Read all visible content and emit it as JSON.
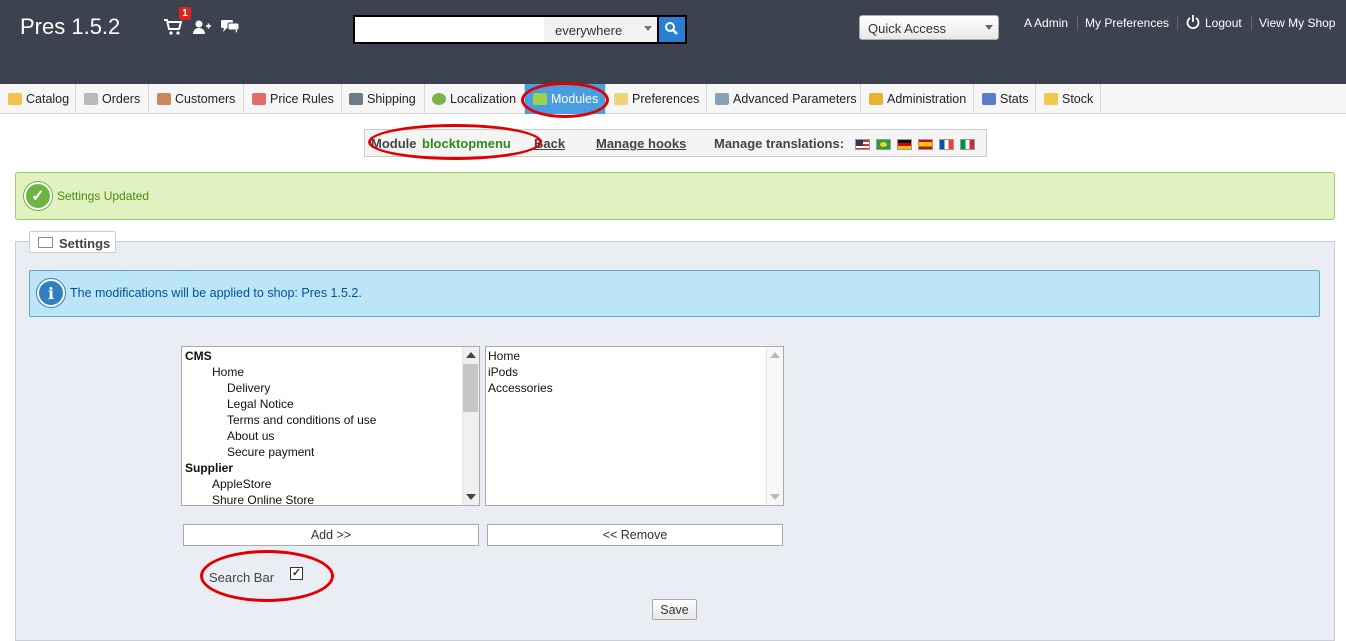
{
  "header": {
    "shop_title": "Pres 1.5.2",
    "orders_badge": "1",
    "search": {
      "value": "",
      "scope": "everywhere"
    },
    "quick_access": "Quick Access",
    "links": {
      "admin": "A Admin",
      "preferences": "My Preferences",
      "logout": "Logout",
      "view_shop": "View My Shop"
    }
  },
  "tabs": [
    {
      "label": "Catalog",
      "icon": "folder-icon"
    },
    {
      "label": "Orders",
      "icon": "cart-icon"
    },
    {
      "label": "Customers",
      "icon": "customer-icon"
    },
    {
      "label": "Price Rules",
      "icon": "price-tag-icon"
    },
    {
      "label": "Shipping",
      "icon": "truck-icon"
    },
    {
      "label": "Localization",
      "icon": "globe-icon"
    },
    {
      "label": "Modules",
      "icon": "puzzle-icon",
      "active": true
    },
    {
      "label": "Preferences",
      "icon": "preferences-icon"
    },
    {
      "label": "Advanced Parameters",
      "icon": "wrench-icon"
    },
    {
      "label": "Administration",
      "icon": "key-icon"
    },
    {
      "label": "Stats",
      "icon": "bar-chart-icon"
    },
    {
      "label": "Stock",
      "icon": "box-icon"
    }
  ],
  "module_bar": {
    "module_prefix": "Module",
    "module_name": "blocktopmenu",
    "back": "Back",
    "manage_hooks": "Manage hooks",
    "manage_translations": "Manage translations:",
    "flags": [
      "en",
      "br",
      "de",
      "es",
      "fr",
      "it"
    ]
  },
  "success_message": "Settings Updated",
  "settings": {
    "legend": "Settings",
    "info": "The modifications will be applied to shop: Pres 1.5.2.",
    "available_items": [
      {
        "label": "CMS",
        "level": 0,
        "bold": true
      },
      {
        "label": "Home",
        "level": 1
      },
      {
        "label": "Delivery",
        "level": 2
      },
      {
        "label": "Legal Notice",
        "level": 2
      },
      {
        "label": "Terms and conditions of use",
        "level": 2
      },
      {
        "label": "About us",
        "level": 2
      },
      {
        "label": "Secure payment",
        "level": 2
      },
      {
        "label": "Supplier",
        "level": 0,
        "bold": true
      },
      {
        "label": "AppleStore",
        "level": 1
      },
      {
        "label": "Shure Online Store",
        "level": 1
      }
    ],
    "selected_items": [
      "Home",
      "iPods",
      "Accessories"
    ],
    "add_button": "Add >>",
    "remove_button": "<< Remove",
    "search_bar_label": "Search Bar",
    "search_bar_checked": true,
    "save_button": "Save"
  },
  "colors": {
    "header_bg": "#3c4250",
    "active_tab": "#4a9de0",
    "annotation_red": "#e00000",
    "module_name": "#2e8b1e"
  }
}
